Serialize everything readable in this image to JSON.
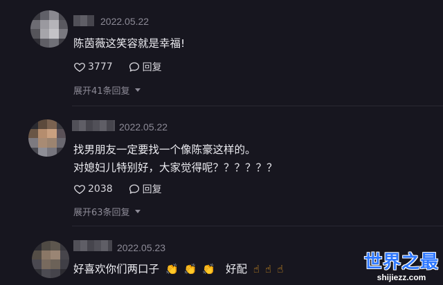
{
  "comments": [
    {
      "date": "2022.05.22",
      "lines": [
        "陈茵薇这笑容就是幸福!"
      ],
      "likes": "3777",
      "reply_label": "回复",
      "expand_label": "展开41条回复"
    },
    {
      "date": "2022.05.22",
      "lines": [
        "找男朋友一定要找一个像陈豪这样的。",
        "对媳妇儿特别好，大家觉得呢？？？？？？"
      ],
      "likes": "2038",
      "reply_label": "回复",
      "expand_label": "展开63条回复"
    },
    {
      "date": "2022.05.23",
      "text_a": "好喜欢你们两口子",
      "text_b": "好配"
    }
  ],
  "icons": {
    "like": "heart-icon",
    "reply": "speech-bubble-icon",
    "expand": "caret-down-icon",
    "clap": "clapping-hands-emoji",
    "point_up": "hand-pointing-up-emoji"
  },
  "watermark": {
    "line1": "世界之最",
    "line2": "shijiezz.com"
  },
  "colors": {
    "background": "#17161f",
    "text": "#ececf1",
    "muted": "#8d8b97",
    "watermark_blue": "#2f78ff"
  }
}
